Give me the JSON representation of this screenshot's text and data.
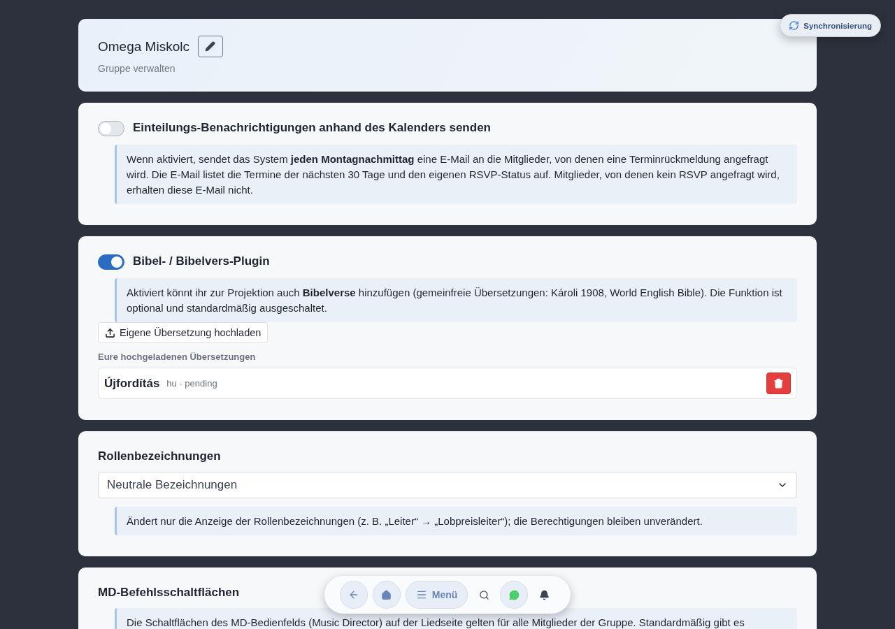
{
  "sync_button": {
    "label": "Synchronisierung"
  },
  "header": {
    "title": "Omega Miskolc",
    "subtitle": "Gruppe verwalten"
  },
  "sections": [
    {
      "kind": "toggle",
      "title": "Einteilungs-Benachrichtigungen anhand des Kalenders senden",
      "on": false,
      "info": "Wenn aktiviert, sendet das System **jeden Montagnachmittag** eine E-Mail an die Mitglieder, von denen eine Terminrückmeldung angefragt wird. Die E-Mail listet die Termine der nächsten 30 Tage und den eigenen RSVP-Status auf. Mitglieder, von denen kein RSVP angefragt wird, erhalten diese E-Mail nicht."
    },
    {
      "kind": "toggle",
      "title": "Bibel- / Bibelvers-Plugin",
      "on": true,
      "info": "Aktiviert könnt ihr zur Projektion auch **Bibelverse** hinzufügen (gemeinfreie Übersetzungen: Károli 1908, World English Bible). Die Funktion ist optional und standardmäßig ausgeschaltet.",
      "upload_button": "Eigene Übersetzung hochladen",
      "list_label": "Eure hochgeladenen Übersetzungen",
      "translations": [
        {
          "name": "Újfordítás",
          "meta": "hu · pending"
        }
      ]
    },
    {
      "kind": "select",
      "title": "Rollenbezeichnungen",
      "value": "Neutrale Bezeichnungen",
      "info": "Ändert nur die Anzeige der Rollenbezeichnungen (z. B. „Leiter“ → „Lobpreisleiter“); die Berechtigungen bleiben unverändert."
    },
    {
      "kind": "plain",
      "title": "MD-Befehlsschaltflächen",
      "info": "Die Schaltflächen des MD-Bedienfelds (Music Director) auf der Liedseite gelten für alle Mitglieder der Gruppe. Standardmäßig gibt es"
    }
  ],
  "nav": {
    "menu_label": "Menü"
  }
}
